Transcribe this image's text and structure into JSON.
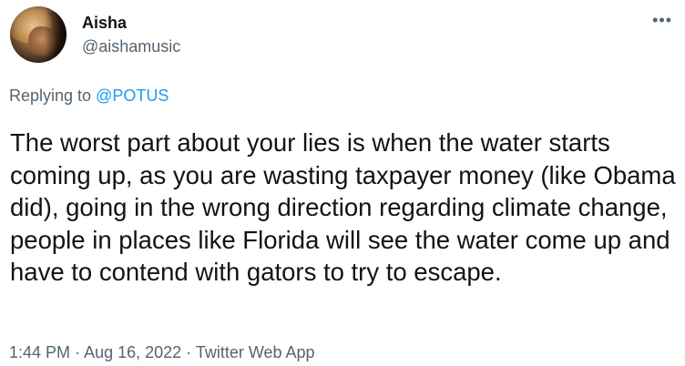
{
  "user": {
    "display_name": "Aisha",
    "handle": "@aishamusic"
  },
  "more_icon": "more-horizontal-icon",
  "reply": {
    "prefix": "Replying to ",
    "mention": "@POTUS"
  },
  "tweet": {
    "text": "The worst part about your lies is when the water starts coming up, as you are wasting taxpayer money (like Obama did), going in the wrong direction regarding climate change, people in places like Florida will see the water come up and have to contend with gators to try to escape."
  },
  "meta": {
    "time": "1:44 PM",
    "date": "Aug 16, 2022",
    "source": "Twitter Web App",
    "separator": " · "
  },
  "colors": {
    "text": "#0f1419",
    "secondary": "#536471",
    "link": "#1d9bf0"
  }
}
